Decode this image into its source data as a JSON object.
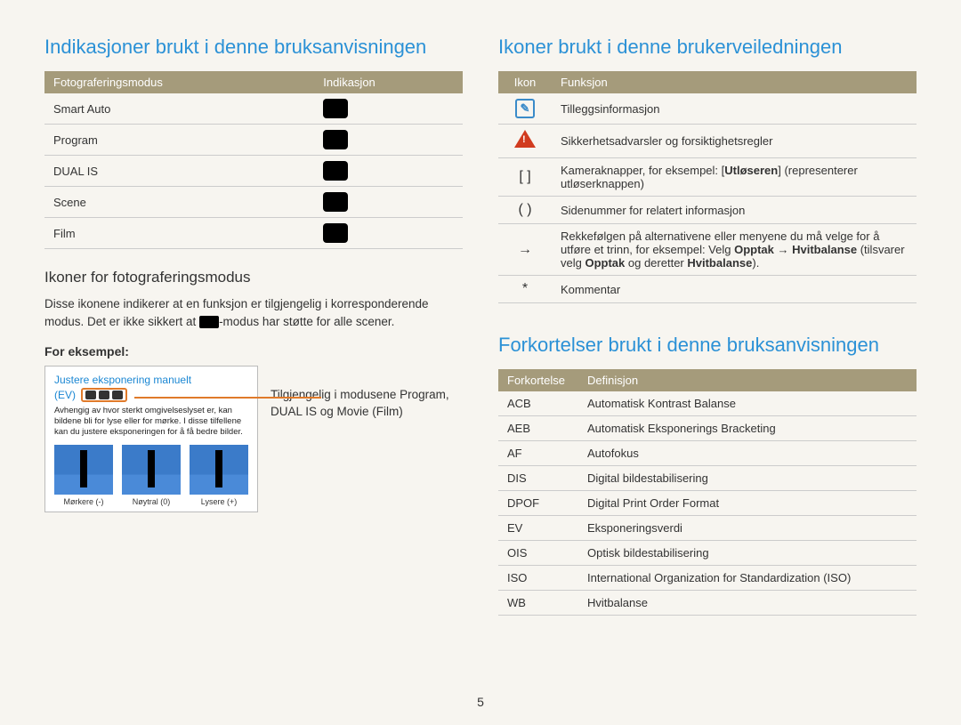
{
  "left": {
    "heading": "Indikasjoner brukt i denne bruksanvisningen",
    "table1": {
      "h1": "Fotograferingsmodus",
      "h2": "Indikasjon",
      "rows": [
        {
          "mode": "Smart Auto"
        },
        {
          "mode": "Program"
        },
        {
          "mode": "DUAL IS"
        },
        {
          "mode": "Scene"
        },
        {
          "mode": "Film"
        }
      ]
    },
    "sub": "Ikoner for fotograferingsmodus",
    "para_a": "Disse ikonene indikerer at en funksjon er tilgjengelig i korresponderende modus. Det er ikke sikkert at ",
    "para_b": "-modus har støtte for alle scener.",
    "for_eks": "For eksempel:",
    "example": {
      "title": "Justere eksponering manuelt",
      "ev": "(EV)",
      "desc": "Avhengig av hvor sterkt omgivelseslyset er, kan bildene bli for lyse eller for mørke. I disse tilfellene kan du justere eksponeringen for å få bedre bilder.",
      "thumbs": [
        {
          "label": "Mørkere (-)"
        },
        {
          "label": "Nøytral (0)"
        },
        {
          "label": "Lysere (+)"
        }
      ]
    },
    "side_note": "Tilgjengelig i modusene Program, DUAL IS og Movie (Film)"
  },
  "right": {
    "heading1": "Ikoner brukt i denne brukerveiledningen",
    "table2": {
      "h1": "Ikon",
      "h2": "Funksjon",
      "rows": [
        {
          "icon": "info",
          "text": "Tilleggsinformasjon"
        },
        {
          "icon": "warn",
          "text": "Sikkerhetsadvarsler og forsiktighetsregler"
        },
        {
          "icon": "[ ]",
          "html": "Kameraknapper, for eksempel: [<b>Utløseren</b>] (representerer utløserknappen)"
        },
        {
          "icon": "( )",
          "text": "Sidenummer for relatert informasjon"
        },
        {
          "icon": "→",
          "html": "Rekkefølgen på alternativene eller menyene du må velge for å utføre et trinn, for eksempel: Velg <b>Opptak</b> → <b>Hvitbalanse</b> (tilsvarer velg <b>Opptak</b> og deretter <b>Hvitbalanse</b>)."
        },
        {
          "icon": "*",
          "text": "Kommentar"
        }
      ]
    },
    "heading2": "Forkortelser brukt i denne bruksanvisningen",
    "table3": {
      "h1": "Forkortelse",
      "h2": "Definisjon",
      "rows": [
        {
          "abbr": "ACB",
          "def": "Automatisk Kontrast Balanse"
        },
        {
          "abbr": "AEB",
          "def": "Automatisk Eksponerings Bracketing"
        },
        {
          "abbr": "AF",
          "def": "Autofokus"
        },
        {
          "abbr": "DIS",
          "def": "Digital bildestabilisering"
        },
        {
          "abbr": "DPOF",
          "def": "Digital Print Order Format"
        },
        {
          "abbr": "EV",
          "def": "Eksponeringsverdi"
        },
        {
          "abbr": "OIS",
          "def": "Optisk bildestabilisering"
        },
        {
          "abbr": "ISO",
          "def": "International Organization for Standardization (ISO)"
        },
        {
          "abbr": "WB",
          "def": "Hvitbalanse"
        }
      ]
    }
  },
  "page": "5"
}
